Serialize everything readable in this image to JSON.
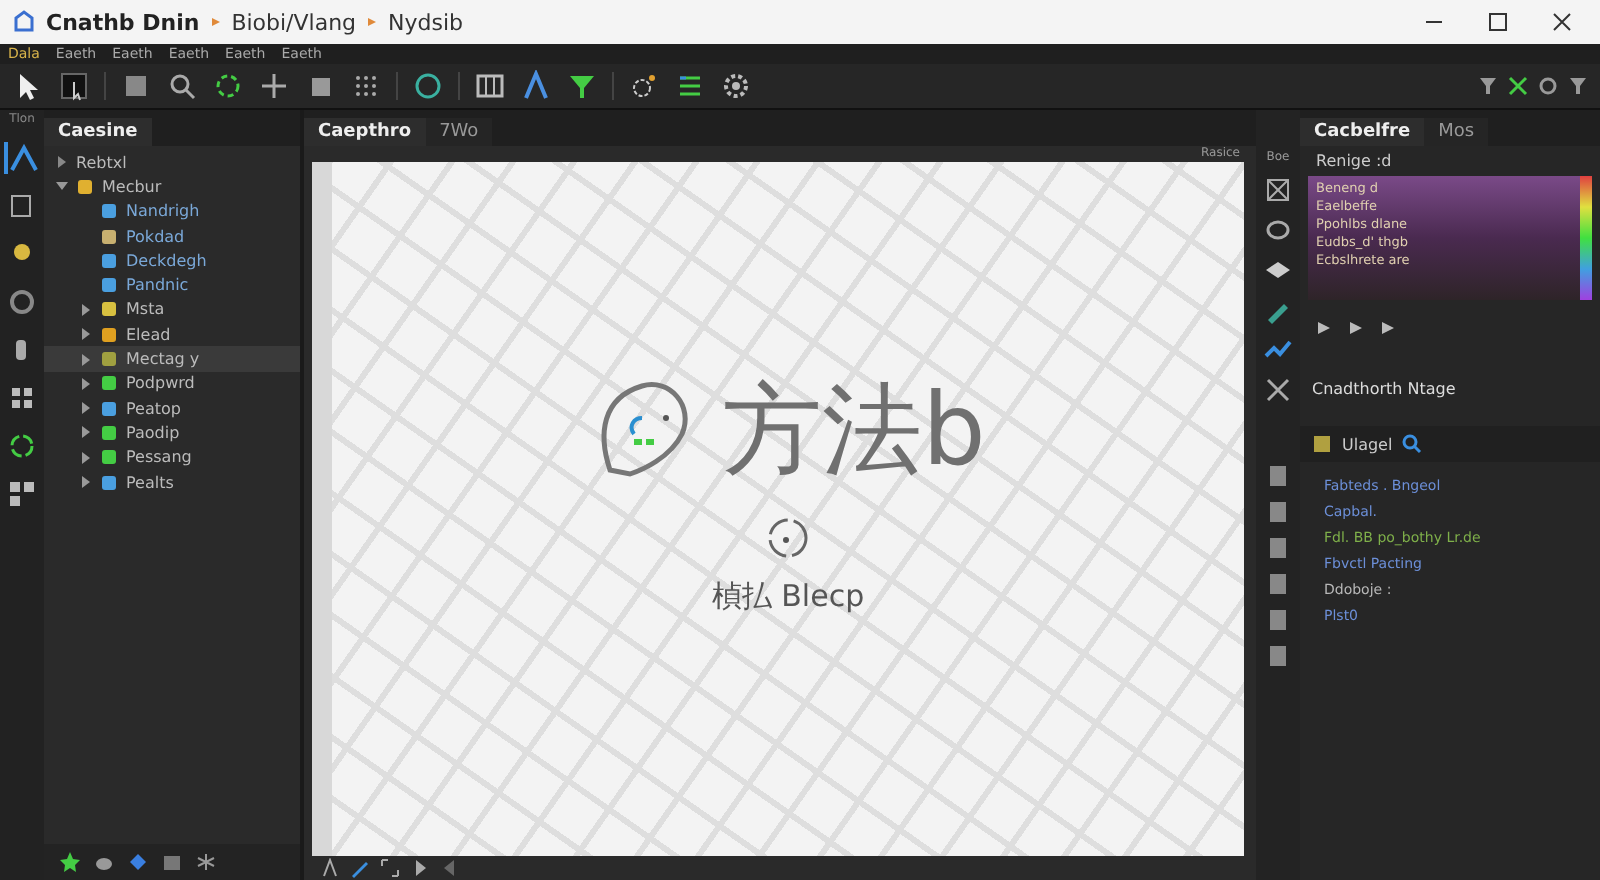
{
  "window": {
    "title": "Cnathb Dnin",
    "path": [
      "Biobi/Vlang",
      "Nydsib"
    ]
  },
  "menu": [
    "Dala",
    "Eaeth",
    "Eaeth",
    "Eaeth",
    "Eaeth",
    "Eaeth"
  ],
  "left_strip": {
    "label": "Tlon"
  },
  "left_panel": {
    "tab": "Caesine",
    "header": "Rebtxl",
    "tree": [
      {
        "label": "Mecbur",
        "kind": "folder",
        "expanded": true,
        "selected": false,
        "children": [
          {
            "label": "Nandrigh",
            "kind": "leaf",
            "selected": false
          },
          {
            "label": "Pokdad",
            "kind": "leaf",
            "selected": false
          },
          {
            "label": "Deckdegh",
            "kind": "leaf",
            "selected": false
          },
          {
            "label": "Pandnic",
            "kind": "leaf",
            "selected": false
          },
          {
            "label": "Msta",
            "kind": "folder",
            "expanded": false,
            "selected": false
          },
          {
            "label": "Elead",
            "kind": "folder",
            "expanded": false,
            "selected": false
          },
          {
            "label": "Mectag y",
            "kind": "folder",
            "expanded": false,
            "selected": true
          },
          {
            "label": "Podpwrd",
            "kind": "folder",
            "expanded": false,
            "selected": false
          },
          {
            "label": "Peatop",
            "kind": "folder",
            "expanded": false,
            "selected": false
          },
          {
            "label": "Paodip",
            "kind": "folder",
            "expanded": false,
            "selected": false
          },
          {
            "label": "Pessang",
            "kind": "folder",
            "expanded": false,
            "selected": false
          },
          {
            "label": "Pealts",
            "kind": "folder",
            "expanded": false,
            "selected": false
          }
        ]
      }
    ]
  },
  "center": {
    "tabs": [
      {
        "label": "Caepthro",
        "selected": true
      },
      {
        "label": "7Wo",
        "selected": false
      }
    ],
    "corner_label": "Rasice",
    "title": "方法b",
    "subtitle": "楨払 Blecp"
  },
  "right_panel": {
    "tabs": [
      {
        "label": "Cacbelfre",
        "selected": true
      },
      {
        "label": "Mos",
        "selected": false
      }
    ],
    "header": "Renige :d",
    "preview_lines": [
      "Beneng d",
      "Eaelbeffe",
      "Ppohlbs dlane",
      "Eudbs_d' thgb",
      "Ecbslhrete are"
    ],
    "section": "Cnadthorth Ntage",
    "layer": "Ulagel",
    "side_label": "Boe",
    "code_lines": [
      {
        "text": "Fabteds . Bngeol",
        "color": "#6c8fd8"
      },
      {
        "text": "Capbal.",
        "color": "#6c8fd8"
      },
      {
        "text": "Fdl. BB po_bothy Lr.de",
        "color": "#7fb04a"
      },
      {
        "text": "Fbvctl Pacting",
        "color": "#6c8fd8"
      },
      {
        "text": "Ddoboje :",
        "color": "#b8b8b8"
      },
      {
        "text": "Plst0",
        "color": "#6c8fd8"
      }
    ]
  }
}
